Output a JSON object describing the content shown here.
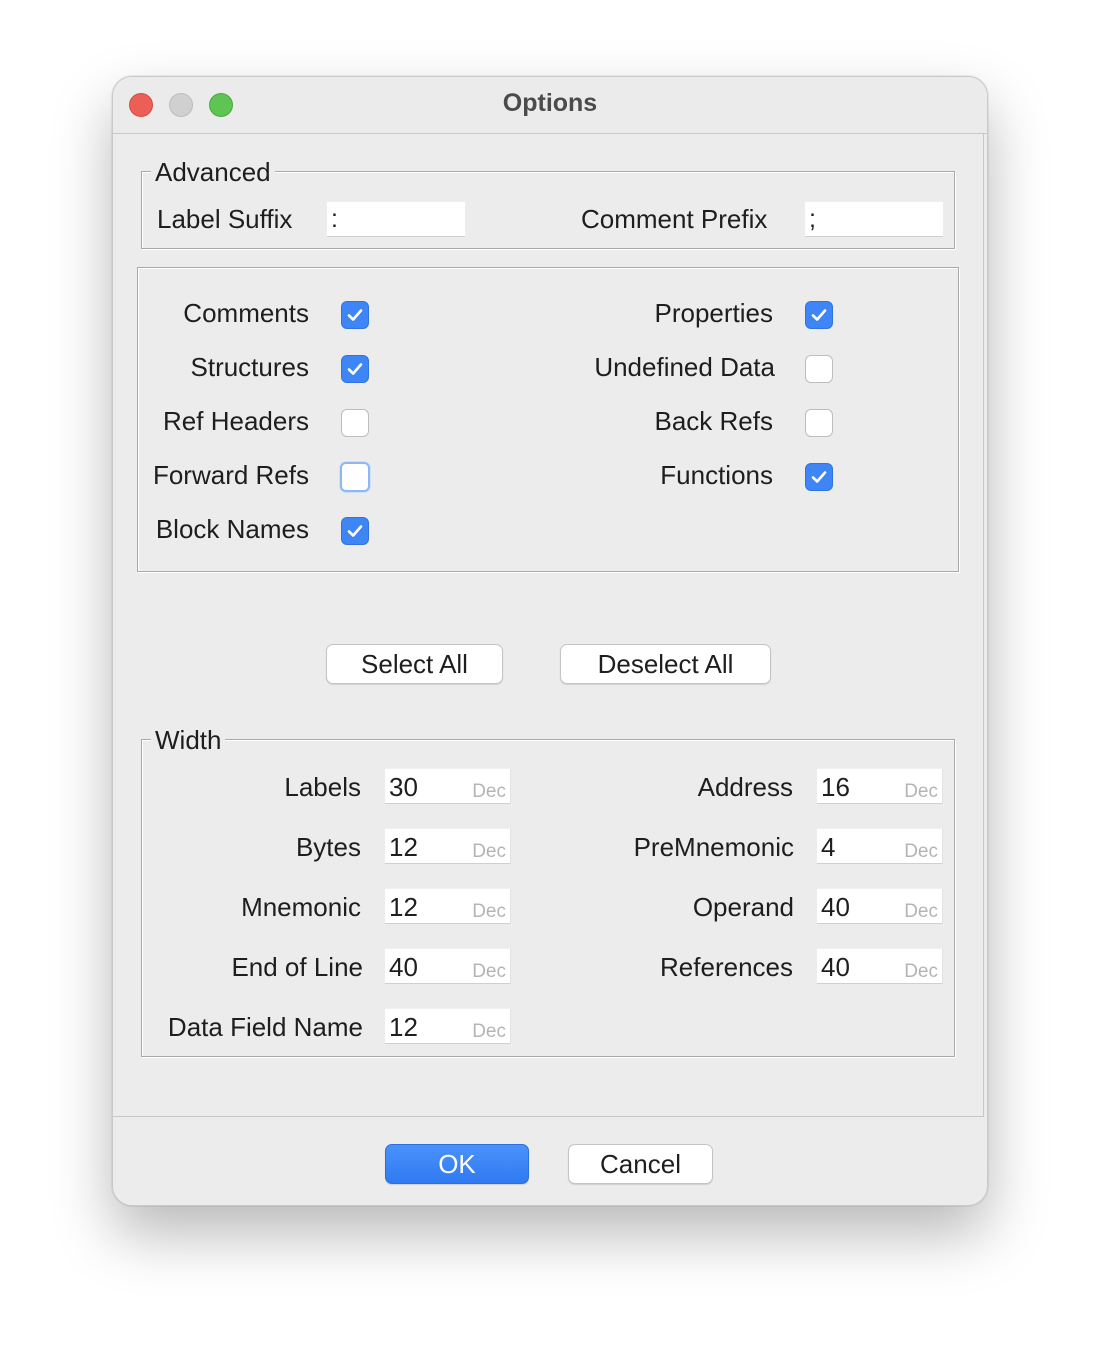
{
  "window": {
    "title": "Options"
  },
  "advanced": {
    "legend": "Advanced",
    "label_suffix_label": "Label Suffix",
    "label_suffix_value": ":",
    "comment_prefix_label": "Comment Prefix",
    "comment_prefix_value": ";"
  },
  "checkboxes": {
    "comments": {
      "label": "Comments",
      "checked": true
    },
    "structures": {
      "label": "Structures",
      "checked": true
    },
    "ref_headers": {
      "label": "Ref Headers",
      "checked": false
    },
    "forward_refs": {
      "label": "Forward Refs",
      "checked": false
    },
    "block_names": {
      "label": "Block Names",
      "checked": true
    },
    "properties": {
      "label": "Properties",
      "checked": true
    },
    "undefined_data": {
      "label": "Undefined Data",
      "checked": false
    },
    "back_refs": {
      "label": "Back Refs",
      "checked": false
    },
    "functions": {
      "label": "Functions",
      "checked": true
    }
  },
  "buttons": {
    "select_all": "Select All",
    "deselect_all": "Deselect All",
    "ok": "OK",
    "cancel": "Cancel"
  },
  "width": {
    "legend": "Width",
    "unit": "Dec",
    "labels": {
      "label": "Labels",
      "value": "30"
    },
    "bytes": {
      "label": "Bytes",
      "value": "12"
    },
    "mnemonic": {
      "label": "Mnemonic",
      "value": "12"
    },
    "end_of_line": {
      "label": "End of Line",
      "value": "40"
    },
    "data_field_name": {
      "label": "Data Field Name",
      "value": "12"
    },
    "address": {
      "label": "Address",
      "value": "16"
    },
    "premnemonic": {
      "label": "PreMnemonic",
      "value": "4"
    },
    "operand": {
      "label": "Operand",
      "value": "40"
    },
    "references": {
      "label": "References",
      "value": "40"
    }
  },
  "colors": {
    "accent": "#3e86f5",
    "close": "#ec5f57",
    "minimize": "#d0d0d0",
    "maximize": "#5fc454"
  }
}
